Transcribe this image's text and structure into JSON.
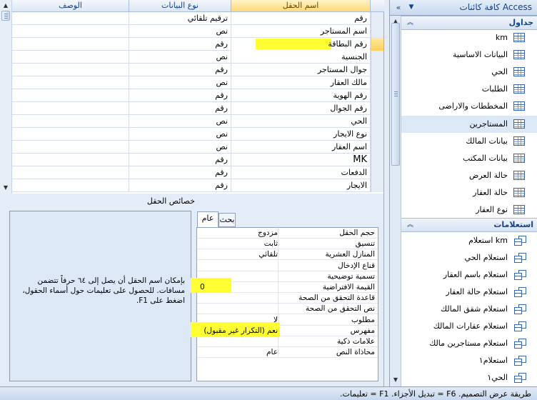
{
  "nav": {
    "title": "كافة كائنات Access",
    "menu_icon": "chevron-down-icon",
    "close_icon": "double-chevron-left-icon",
    "tables_group": "جداول",
    "tables": [
      "km",
      "البيانات الاساسية",
      "الحي",
      "الطلبات",
      "المخططات والاراضى",
      "المستاجرين",
      "بيانات المالك",
      "بيانات المكتب",
      "حالة العرض",
      "حالة العقار",
      "نوع العقار"
    ],
    "selected_table_index": 5,
    "queries_group": "استعلامات",
    "queries": [
      "km استعلام",
      "استعلام الحي",
      "استعلام باسم العقار",
      "استعلام حالة العقار",
      "استعلام شقق المالك",
      "استعلام عقارات المالك",
      "استعلام مستاجرين مالك",
      "استعلام١",
      "الحي١"
    ]
  },
  "grid": {
    "headers": {
      "name": "اسم الحقل",
      "type": "نوع البيانات",
      "desc": "الوصف"
    },
    "rows": [
      {
        "name": "رقم",
        "type": "ترقيم تلقائي",
        "desc": ""
      },
      {
        "name": "اسم المستاجر",
        "type": "نص",
        "desc": ""
      },
      {
        "name": "رقم البطاقة",
        "type": "رقم",
        "desc": ""
      },
      {
        "name": "الجنسية",
        "type": "نص",
        "desc": ""
      },
      {
        "name": "جوال المستاجر",
        "type": "رقم",
        "desc": ""
      },
      {
        "name": "مالك العقار",
        "type": "نص",
        "desc": ""
      },
      {
        "name": "رقم الهوية",
        "type": "رقم",
        "desc": ""
      },
      {
        "name": "رقم الجوال",
        "type": "رقم",
        "desc": ""
      },
      {
        "name": "الحي",
        "type": "نص",
        "desc": ""
      },
      {
        "name": "نوع الايجار",
        "type": "نص",
        "desc": ""
      },
      {
        "name": "اسم العقار",
        "type": "نص",
        "desc": ""
      },
      {
        "name": "MK",
        "type": "رقم",
        "desc": ""
      },
      {
        "name": "الدفعات",
        "type": "رقم",
        "desc": ""
      },
      {
        "name": "الايجار",
        "type": "رقم",
        "desc": ""
      }
    ],
    "current_row_index": 2
  },
  "properties": {
    "title": "خصائص الحقل",
    "tabs": [
      "عام",
      "بحث"
    ],
    "help_text": "بإمكان اسم الحقل أن يصل إلى ٦٤ حرفاً تتضمن مسافات. للحصول على تعليمات حول أسماء الحقول، اضغط على F1.",
    "rows": [
      {
        "label": "حجم الحقل",
        "value": "مزدوج"
      },
      {
        "label": "تنسيق",
        "value": "ثابت"
      },
      {
        "label": "المنازل العشرية",
        "value": "تلقائي"
      },
      {
        "label": "قناع الإدخال",
        "value": ""
      },
      {
        "label": "تسمية توضيحية",
        "value": ""
      },
      {
        "label": "القيمة الافتراضية",
        "value": "0"
      },
      {
        "label": "قاعدة التحقق من الصحة",
        "value": ""
      },
      {
        "label": "نص التحقق من الصحة",
        "value": ""
      },
      {
        "label": "مطلوب",
        "value": "لا"
      },
      {
        "label": "مفهرس",
        "value": "نعم (التكرار غير مقبول)"
      },
      {
        "label": "علامات ذكية",
        "value": ""
      },
      {
        "label": "محاذاة النص",
        "value": "عام"
      }
    ]
  },
  "status": "طريقة عرض التصميم. F6 = تبديل الأجزاء. F1 = تعليمات.",
  "colors": {
    "highlight": "#ffff33",
    "accent": "#15428b",
    "active_header": "#ffd87a"
  }
}
